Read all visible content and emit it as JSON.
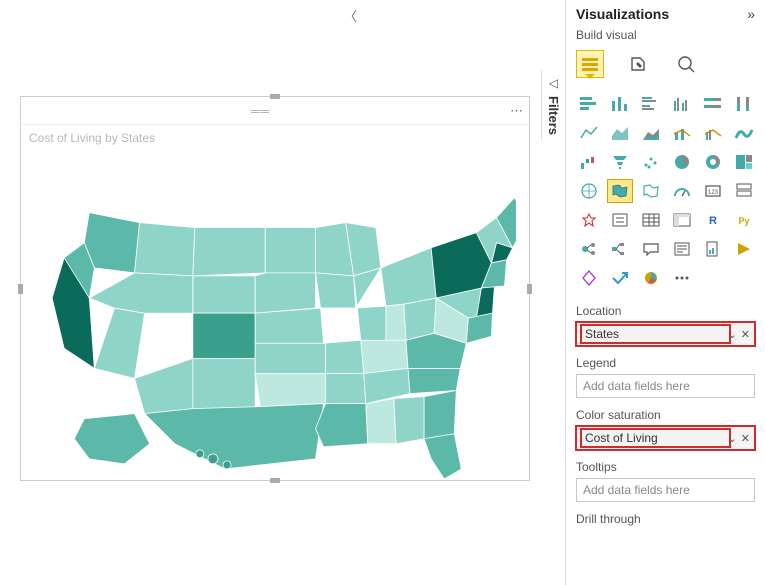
{
  "panel": {
    "title": "Visualizations",
    "subtitle": "Build visual"
  },
  "filtersTab": "Filters",
  "visual": {
    "title": "Cost of Living by States"
  },
  "fields": {
    "location": {
      "label": "Location",
      "value": "States"
    },
    "legend": {
      "label": "Legend",
      "placeholder": "Add data fields here"
    },
    "saturation": {
      "label": "Color saturation",
      "value": "Cost of Living"
    },
    "tooltips": {
      "label": "Tooltips",
      "placeholder": "Add data fields here"
    },
    "drill": {
      "label": "Drill through"
    }
  },
  "gallery": [
    "stacked-bar",
    "stacked-column",
    "clustered-bar",
    "clustered-column",
    "100-bar",
    "100-column",
    "line",
    "area",
    "stacked-area",
    "line-column",
    "line-clustered",
    "ribbon",
    "waterfall",
    "funnel",
    "scatter",
    "pie",
    "donut",
    "treemap",
    "map",
    "filled-map",
    "shape-map",
    "gauge",
    "card",
    "multi-card",
    "kpi",
    "slicer",
    "table",
    "matrix",
    "r-visual",
    "py-visual",
    "key-influencers",
    "decomposition",
    "qa",
    "narrative",
    "paginated",
    "score",
    "powerapps",
    "automate",
    "more"
  ],
  "colors": {
    "teal1": "#bce8e0",
    "teal2": "#8fd4c8",
    "teal3": "#5cb8a8",
    "teal4": "#3a9f8d",
    "dark": "#0a6b5a"
  }
}
